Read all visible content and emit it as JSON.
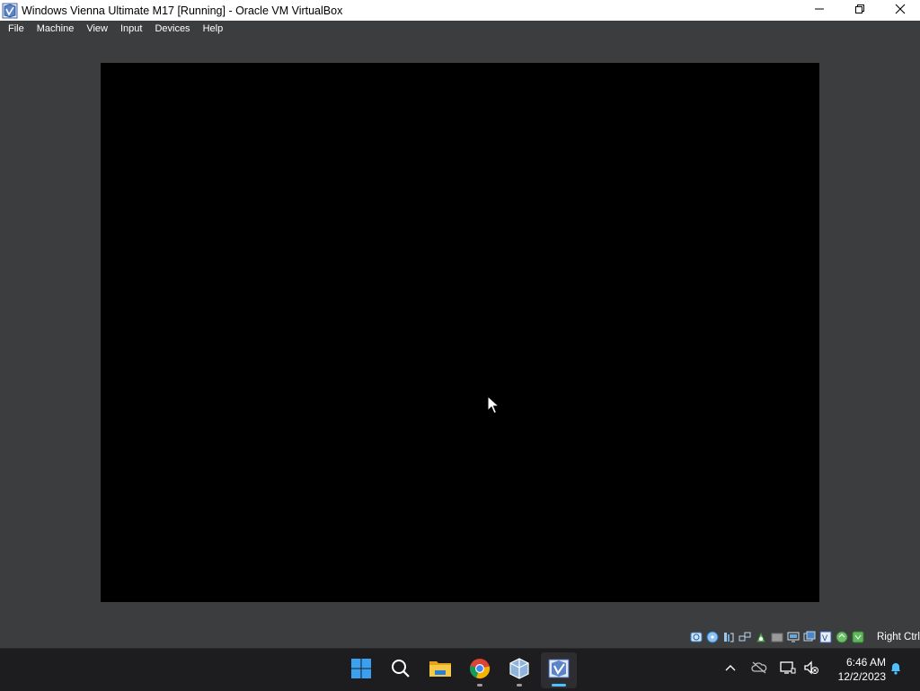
{
  "window": {
    "title": "Windows Vienna Ultimate M17 [Running] - Oracle VM VirtualBox",
    "controls": [
      "minimize-icon",
      "restore-icon",
      "close-icon"
    ]
  },
  "menu": {
    "items": [
      {
        "label": "File"
      },
      {
        "label": "Machine"
      },
      {
        "label": "View"
      },
      {
        "label": "Input"
      },
      {
        "label": "Devices"
      },
      {
        "label": "Help"
      }
    ]
  },
  "vm_display": {
    "background": "#000000",
    "cursor": "mouse-pointer-icon"
  },
  "statusbar": {
    "icons": [
      "hard-disk-icon",
      "optical-drive-icon",
      "audio-icon",
      "network-icon",
      "usb-icon",
      "shared-folders-icon",
      "display-icon",
      "recording-icon",
      "cpu-icon",
      "mouse-integration-icon",
      "keyboard-capture-icon"
    ],
    "host_key": "Right Ctrl"
  },
  "taskbar": {
    "apps": [
      {
        "name": "start-icon"
      },
      {
        "name": "search-icon"
      },
      {
        "name": "file-explorer-icon"
      },
      {
        "name": "chrome-icon",
        "running": true
      },
      {
        "name": "virtualbox-icon",
        "running": true
      },
      {
        "name": "virtualbox-vm-icon",
        "running": true,
        "active": true
      }
    ],
    "tray": {
      "icons": [
        "chevron-up-icon",
        "onedrive-icon",
        "network-icon",
        "volume-muted-icon",
        "notifications-icon"
      ],
      "time": "6:46 AM",
      "date": "12/2/2023"
    }
  },
  "colors": {
    "window_background": "#3c3d3f",
    "taskbar_background": "#1d1d1f",
    "accent": "#4cc2ff"
  }
}
